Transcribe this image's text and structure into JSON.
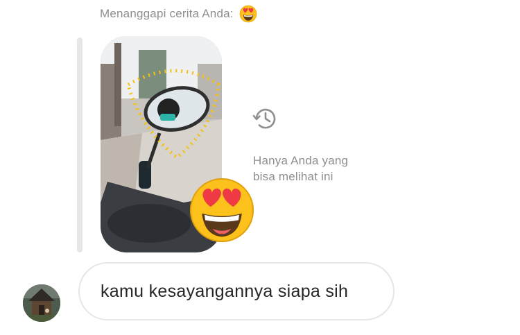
{
  "story_reply": {
    "header_label": "Menanggapi cerita Anda:",
    "header_emoji": "heart-eyes-emoji",
    "reaction_emoji": "heart-eyes-emoji",
    "expired_icon": "history-clock-icon",
    "expired_notice_line1": "Hanya Anda yang",
    "expired_notice_line2": "bisa melihat ini"
  },
  "message": {
    "text": "kamu kesayangannya siapa sih"
  },
  "colors": {
    "muted_text": "#8e8e8e",
    "bubble_border": "#e6e6e6",
    "message_text": "#262626",
    "quote_bar": "#e7e7e7"
  }
}
